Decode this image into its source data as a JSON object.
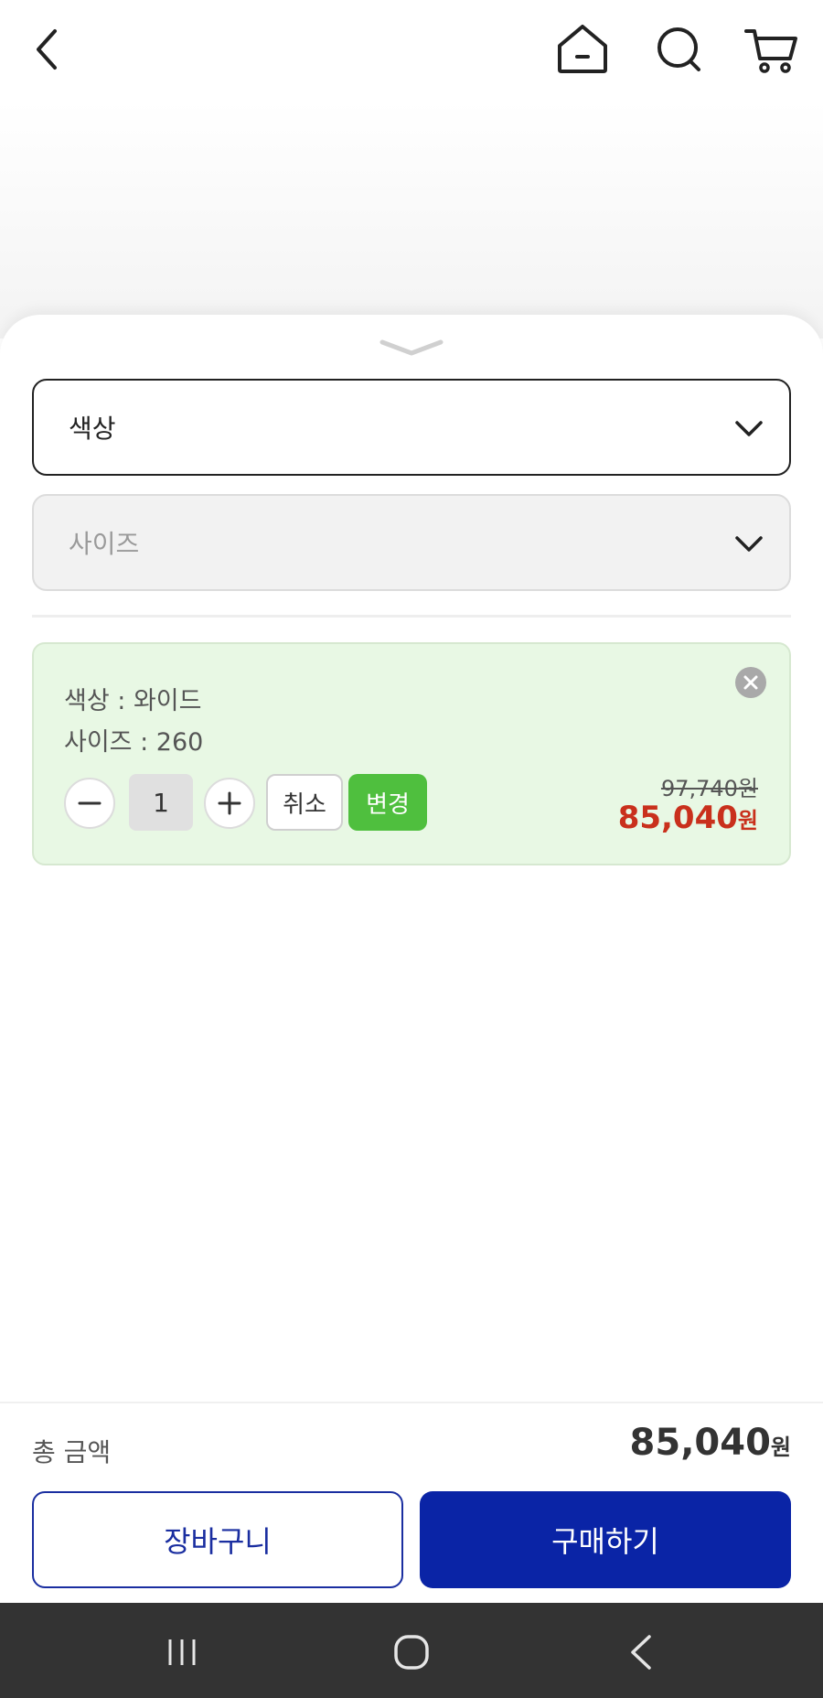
{
  "topbar": {
    "icons": [
      "back-arrow-icon",
      "home-icon",
      "search-icon",
      "cart-icon"
    ]
  },
  "options": {
    "color_select": {
      "label": "색상"
    },
    "size_select": {
      "label": "사이즈"
    }
  },
  "selected_option": {
    "color_line": "색상 : 와이드",
    "size_line": "사이즈 : 260",
    "quantity": "1",
    "cancel_label": "취소",
    "change_label": "변경",
    "original_price": "97,740원",
    "sale_price": "85,040",
    "sale_unit": "원"
  },
  "footer": {
    "total_label": "총 금액",
    "total_price": "85,040",
    "total_unit": "원",
    "cart_button": "장바구니",
    "buy_button": "구매하기"
  },
  "colors": {
    "accent_blue": "#0a24a6",
    "sale_red": "#c9301c",
    "change_green": "#4fbf3e",
    "option_bg": "#e8f8e4"
  }
}
